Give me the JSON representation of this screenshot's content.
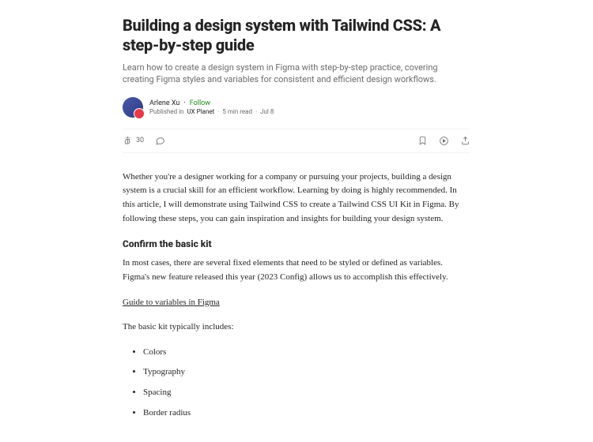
{
  "title": "Building a design system with Tailwind CSS: A step-by-step guide",
  "subtitle": "Learn how to create a design system in Figma with step-by-step practice, covering creating Figma styles and variables for consistent and efficient design workflows.",
  "author": "Arlene Xu",
  "follow": "Follow",
  "published_prefix": "Published in",
  "publication": "UX Planet",
  "read_time": "5 min read",
  "date": "Jul 8",
  "claps": "30",
  "intro": "Whether you're a designer working for a company or pursuing your projects, building a design system is a crucial skill for an efficient workflow. Learning by doing is highly recommended. In this article, I will demonstrate using Tailwind CSS to create a Tailwind CSS UI Kit in Figma. By following these steps, you can gain inspiration and insights for building your design system.",
  "section1_heading": "Confirm the basic kit",
  "section1_p1": "In most cases, there are several fixed elements that need to be styled or defined as variables. Figma's new feature released this year (2023 Config) allows us to accomplish this effectively.",
  "guide_link": "Guide to variables in Figma",
  "list_intro": "The basic kit typically includes:",
  "list": [
    "Colors",
    "Typography",
    "Spacing",
    "Border radius"
  ]
}
